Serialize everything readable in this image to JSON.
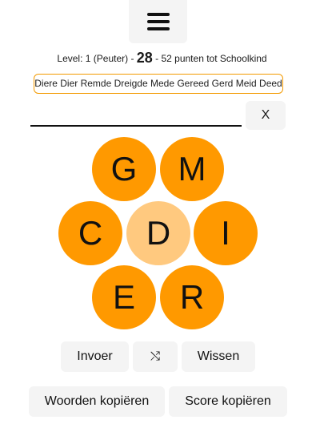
{
  "menu": {
    "icon": "hamburger-menu-icon"
  },
  "status": {
    "level_text": "Level: 1 (Peuter) - ",
    "score": "28",
    "to_next_text": " - 52 punten tot Schoolkind"
  },
  "found_words": "Diere Dier Remde Dreigde Mede Gereed Gerd Meid Deed",
  "input": {
    "value": ""
  },
  "clear_label": "X",
  "letters": {
    "top_left": "G",
    "top_right": "M",
    "mid_left": "C",
    "center": "D",
    "mid_right": "I",
    "bottom_left": "E",
    "bottom_right": "R"
  },
  "colors": {
    "letter_bg": "#ff9900",
    "center_bg": "#ffc97f",
    "found_border": "#f39a00"
  },
  "buttons": {
    "enter": "Invoer",
    "shuffle_icon": "shuffle-icon",
    "shuffle_glyph": "⤭",
    "delete": "Wissen",
    "copy_words": "Woorden kopiëren",
    "copy_score": "Score kopiëren"
  }
}
